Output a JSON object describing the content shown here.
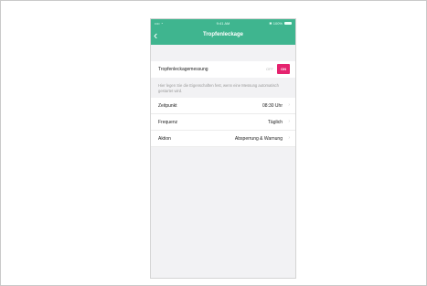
{
  "status": {
    "signal": "•••• ◔",
    "time": "9:41 AM",
    "battery": "✱ 100%"
  },
  "nav": {
    "back_icon": "chevron-left-icon",
    "back_glyph": "‹",
    "title": "Tropfenleckage"
  },
  "measurement": {
    "label": "Tropfenleckagemessung",
    "toggle_off": "OFF",
    "toggle_on": "ON",
    "state": "on",
    "accent": "#e5236f"
  },
  "description": "Hier legen Sie die Eigenschaften fest, wenn eine Messung automatisch gestartet wird.",
  "settings": [
    {
      "label": "Zeitpunkt",
      "value": "08:30 Uhr"
    },
    {
      "label": "Frequenz",
      "value": "Täglich"
    },
    {
      "label": "Aktion",
      "value": "Absperrung & Warnung"
    }
  ],
  "chevron_glyph": "›",
  "colors": {
    "header": "#3fb58f",
    "background": "#f2f2f4"
  }
}
